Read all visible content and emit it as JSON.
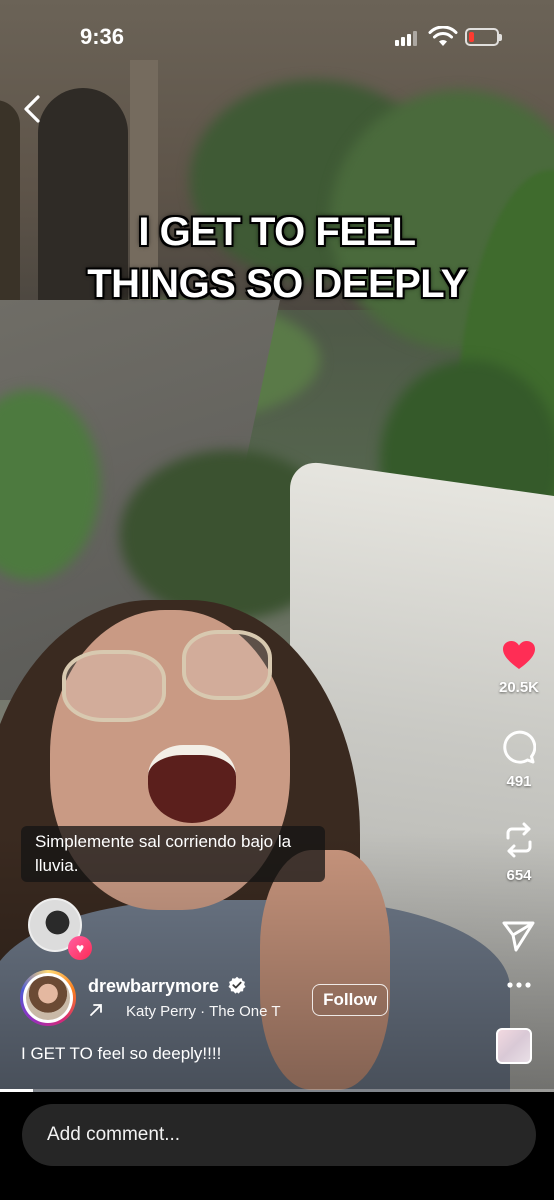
{
  "status_bar": {
    "time": "9:36"
  },
  "video": {
    "overlay_text_line1": "I GET TO FEEL",
    "overlay_text_line2": "THINGS SO DEEPLY",
    "subtitle": "Simplemente sal corriendo bajo la lluvia.",
    "progress": 0.06
  },
  "actions": {
    "likes": "20.5K",
    "comments": "491",
    "reposts": "654",
    "like_color": "#ff2d55"
  },
  "author": {
    "username": "drewbarrymore",
    "verified": true,
    "music": "Katy Perry · The One T",
    "follow_label": "Follow"
  },
  "post": {
    "caption": "I GET TO feel so deeply!!!!"
  },
  "comment": {
    "placeholder": "Add comment..."
  },
  "icons": {
    "back": "chevron-left-icon",
    "like": "heart-icon",
    "comment": "comment-icon",
    "repost": "repost-icon",
    "share": "send-icon",
    "more": "more-icon",
    "verified": "verified-badge-icon"
  }
}
